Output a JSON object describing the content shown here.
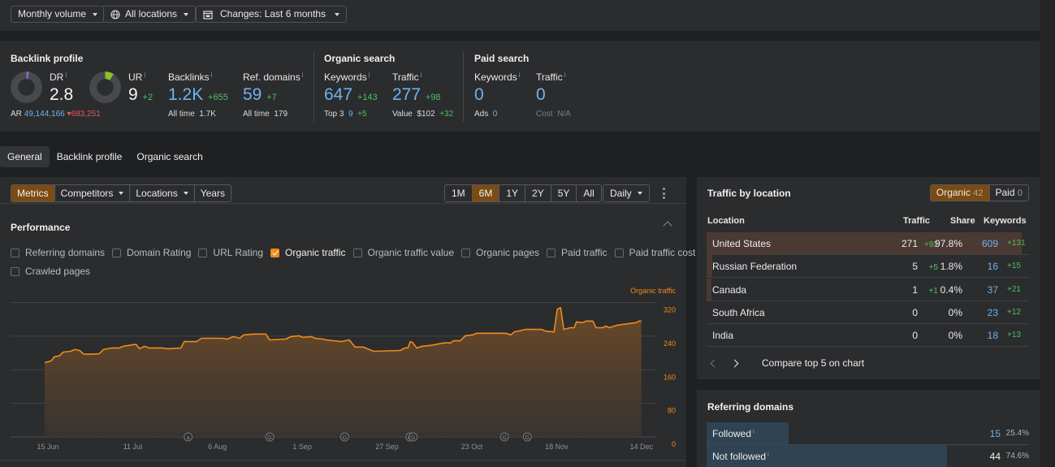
{
  "topbar": {
    "volume_label": "Monthly volume",
    "locations_label": "All locations",
    "changes_label": "Changes: Last 6 months"
  },
  "overview": {
    "backlink_profile": {
      "title": "Backlink profile",
      "dr": {
        "label": "DR",
        "value": "2.8",
        "gauge_fraction": 0.028,
        "gauge_color": "#8a63d2"
      },
      "ar": {
        "label": "AR",
        "value": "49,144,166",
        "delta": "683,251",
        "delta_direction": "down"
      },
      "ur": {
        "label": "UR",
        "value": "9",
        "delta": "+2",
        "gauge_fraction": 0.09,
        "gauge_color": "#8fbf2a"
      },
      "backlinks": {
        "label": "Backlinks",
        "value": "1.2K",
        "delta": "+655",
        "sub_label": "All time",
        "sub_value": "1.7K"
      },
      "ref_domains": {
        "label": "Ref. domains",
        "value": "59",
        "delta": "+7",
        "sub_label": "All time",
        "sub_value": "179"
      }
    },
    "organic_search": {
      "title": "Organic search",
      "keywords": {
        "label": "Keywords",
        "value": "647",
        "delta": "+143",
        "sub_label": "Top 3",
        "sub_value": "9",
        "sub_delta": "+5"
      },
      "traffic": {
        "label": "Traffic",
        "value": "277",
        "delta": "+98",
        "sub_label": "Value",
        "sub_value": "$102",
        "sub_delta": "+32"
      }
    },
    "paid_search": {
      "title": "Paid search",
      "keywords": {
        "label": "Keywords",
        "value": "0",
        "sub_label": "Ads",
        "sub_value": "0"
      },
      "traffic": {
        "label": "Traffic",
        "value": "0",
        "sub_label": "Cost",
        "sub_value": "N/A"
      }
    },
    "info_glyph": "i"
  },
  "tabs": [
    {
      "label": "General",
      "active": true
    },
    {
      "label": "Backlink profile",
      "active": false
    },
    {
      "label": "Organic search",
      "active": false
    }
  ],
  "performance": {
    "view_buttons": [
      {
        "label": "Metrics",
        "active": true,
        "dropdown": false
      },
      {
        "label": "Competitors",
        "active": false,
        "dropdown": true
      },
      {
        "label": "Locations",
        "active": false,
        "dropdown": true
      },
      {
        "label": "Years",
        "active": false,
        "dropdown": false
      }
    ],
    "ranges": [
      {
        "label": "1M",
        "active": false
      },
      {
        "label": "6M",
        "active": true
      },
      {
        "label": "1Y",
        "active": false
      },
      {
        "label": "2Y",
        "active": false
      },
      {
        "label": "5Y",
        "active": false
      },
      {
        "label": "All",
        "active": false
      }
    ],
    "interval_label": "Daily",
    "title": "Performance",
    "metrics": [
      {
        "label": "Referring domains",
        "checked": false
      },
      {
        "label": "Domain Rating",
        "checked": false
      },
      {
        "label": "URL Rating",
        "checked": false
      },
      {
        "label": "Organic traffic",
        "checked": true
      },
      {
        "label": "Organic traffic value",
        "checked": false
      },
      {
        "label": "Organic pages",
        "checked": false
      },
      {
        "label": "Paid traffic",
        "checked": false
      },
      {
        "label": "Paid traffic cost",
        "checked": false
      },
      {
        "label": "Crawled pages",
        "checked": false
      }
    ]
  },
  "chart_data": {
    "type": "area",
    "title": "",
    "series": [
      {
        "name": "Organic traffic",
        "color": "#f08a1c",
        "x_unit": "days since 14 Jun",
        "points": [
          [
            0,
            177
          ],
          [
            2,
            181
          ],
          [
            3,
            191
          ],
          [
            4.5,
            193
          ],
          [
            5.7,
            202
          ],
          [
            8,
            204
          ],
          [
            9.2,
            208
          ],
          [
            10.7,
            206
          ],
          [
            12,
            197
          ],
          [
            14.4,
            197
          ],
          [
            16.7,
            198
          ],
          [
            18,
            208
          ],
          [
            20.7,
            212
          ],
          [
            22.9,
            212
          ],
          [
            24.2,
            216
          ],
          [
            27.4,
            220
          ],
          [
            28.1,
            220
          ],
          [
            29.1,
            210
          ],
          [
            30.6,
            216
          ],
          [
            31.9,
            212
          ],
          [
            36.1,
            212
          ],
          [
            37.9,
            210
          ],
          [
            41.8,
            212
          ],
          [
            42.8,
            227
          ],
          [
            46.6,
            227
          ],
          [
            48.1,
            235
          ],
          [
            54.3,
            235
          ],
          [
            56.1,
            233
          ],
          [
            57.8,
            239
          ],
          [
            59.8,
            235
          ],
          [
            61.1,
            243
          ],
          [
            64.3,
            245
          ],
          [
            67.8,
            245
          ],
          [
            69,
            231
          ],
          [
            74,
            233
          ],
          [
            75.5,
            239
          ],
          [
            78,
            241
          ],
          [
            79.2,
            237
          ],
          [
            81.7,
            239
          ],
          [
            83,
            235
          ],
          [
            85.2,
            233
          ],
          [
            86.4,
            231
          ],
          [
            90.9,
            227
          ],
          [
            93.4,
            231
          ],
          [
            95.2,
            214
          ],
          [
            97.6,
            214
          ],
          [
            100.9,
            204
          ],
          [
            109.1,
            206
          ],
          [
            110.4,
            212
          ],
          [
            111.4,
            212
          ],
          [
            112.1,
            227
          ],
          [
            112.8,
            225
          ],
          [
            114.1,
            212
          ],
          [
            115.8,
            216
          ],
          [
            118.3,
            218
          ],
          [
            122.5,
            224
          ],
          [
            124.5,
            224
          ],
          [
            125.3,
            229
          ],
          [
            127.5,
            229
          ],
          [
            129,
            241
          ],
          [
            131.3,
            243
          ],
          [
            132.5,
            247
          ],
          [
            139,
            247
          ],
          [
            141.4,
            247
          ],
          [
            143,
            243
          ],
          [
            144,
            250
          ],
          [
            147.5,
            256
          ],
          [
            152.4,
            256
          ],
          [
            153.7,
            252
          ],
          [
            156.2,
            250
          ],
          [
            157.2,
            304
          ],
          [
            158.2,
            308
          ],
          [
            159.2,
            256
          ],
          [
            161.2,
            260
          ],
          [
            162.4,
            260
          ],
          [
            163.1,
            274
          ],
          [
            164.9,
            272
          ],
          [
            166.1,
            276
          ],
          [
            168.1,
            276
          ],
          [
            169.1,
            260
          ],
          [
            171.1,
            260
          ],
          [
            172.1,
            264
          ],
          [
            173.1,
            260
          ],
          [
            175.6,
            266
          ],
          [
            177.3,
            268
          ],
          [
            181.3,
            272
          ],
          [
            182.3,
            276
          ],
          [
            183,
            276
          ]
        ]
      }
    ],
    "x_ticks": [
      "15 Jun",
      "11 Jul",
      "6 Aug",
      "1 Sep",
      "27 Sep",
      "23 Oct",
      "18 Nov",
      "14 Dec"
    ],
    "x_tick_days": [
      1,
      27,
      53,
      79,
      105,
      131,
      157,
      183
    ],
    "x_range_days": [
      -10,
      186
    ],
    "ylabel": "Organic traffic",
    "y_ticks": [
      0,
      80,
      160,
      240,
      320
    ],
    "ylim": [
      0,
      320
    ],
    "grid": true,
    "annotations": [
      {
        "day": 44,
        "glyph": "a"
      },
      {
        "day": 69,
        "glyph": "G"
      },
      {
        "day": 92,
        "glyph": "G"
      },
      {
        "day": 112,
        "glyph": "G"
      },
      {
        "day": 113,
        "glyph": "G"
      },
      {
        "day": 141,
        "glyph": "G"
      },
      {
        "day": 148,
        "glyph": "G"
      }
    ]
  },
  "traffic_by_location": {
    "title": "Traffic by location",
    "organic_label": "Organic",
    "organic_count": "42",
    "paid_label": "Paid",
    "paid_count": "0",
    "columns": [
      "Location",
      "Traffic",
      "Share",
      "Keywords"
    ],
    "rows": [
      {
        "location": "United States",
        "traffic": "271",
        "traffic_delta": "+92",
        "share": "97.8%",
        "share_fraction": 0.978,
        "keywords": "609",
        "keywords_delta": "+131"
      },
      {
        "location": "Russian Federation",
        "traffic": "5",
        "traffic_delta": "+5",
        "share": "1.8%",
        "share_fraction": 0.018,
        "keywords": "16",
        "keywords_delta": "+15"
      },
      {
        "location": "Canada",
        "traffic": "1",
        "traffic_delta": "+1",
        "share": "0.4%",
        "share_fraction": 0.004,
        "keywords": "37",
        "keywords_delta": "+21"
      },
      {
        "location": "South Africa",
        "traffic": "0",
        "traffic_delta": "",
        "share": "0%",
        "share_fraction": 0,
        "keywords": "23",
        "keywords_delta": "+12"
      },
      {
        "location": "India",
        "traffic": "0",
        "traffic_delta": "",
        "share": "0%",
        "share_fraction": 0,
        "keywords": "18",
        "keywords_delta": "+13"
      }
    ],
    "compare_label": "Compare top 5 on chart"
  },
  "referring_domains": {
    "title": "Referring domains",
    "rows": [
      {
        "label": "Followed",
        "value": "15",
        "percent": "25.4%",
        "fraction": 0.254,
        "value_color": "#6eb3ee"
      },
      {
        "label": "Not followed",
        "value": "44",
        "percent": "74.6%",
        "fraction": 0.746,
        "value_color": "#f0f0f0"
      }
    ]
  }
}
